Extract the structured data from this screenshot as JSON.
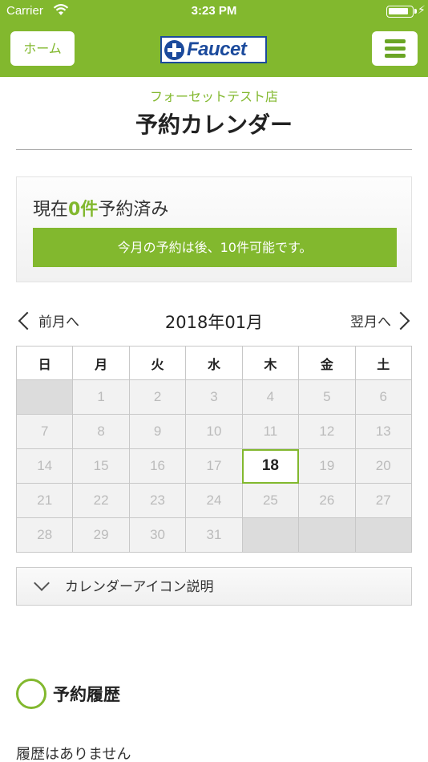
{
  "status_bar": {
    "carrier": "Carrier",
    "time": "3:23 PM",
    "battery_level": 0.9
  },
  "header": {
    "home_label": "ホーム",
    "logo_text": "Faucet"
  },
  "page": {
    "store_name": "フォーセットテスト店",
    "title": "予約カレンダー"
  },
  "summary": {
    "prefix": "現在",
    "count": "0件",
    "suffix": "予約済み",
    "remaining": "今月の予約は後、10件可能です。"
  },
  "calendar": {
    "prev_label": "前月へ",
    "next_label": "翌月へ",
    "month_label": "2018年01月",
    "weekdays": [
      "日",
      "月",
      "火",
      "水",
      "木",
      "金",
      "土"
    ],
    "weeks": [
      [
        "",
        "1",
        "2",
        "3",
        "4",
        "5",
        "6"
      ],
      [
        "7",
        "8",
        "9",
        "10",
        "11",
        "12",
        "13"
      ],
      [
        "14",
        "15",
        "16",
        "17",
        "18",
        "19",
        "20"
      ],
      [
        "21",
        "22",
        "23",
        "24",
        "25",
        "26",
        "27"
      ],
      [
        "28",
        "29",
        "30",
        "31",
        "",
        "",
        ""
      ]
    ],
    "today": "18"
  },
  "legend": {
    "label": "カレンダーアイコン説明"
  },
  "history": {
    "title": "予約履歴",
    "empty_text": "履歴はありません"
  },
  "colors": {
    "brand_green": "#82b82e",
    "logo_blue": "#1b4a9c"
  }
}
